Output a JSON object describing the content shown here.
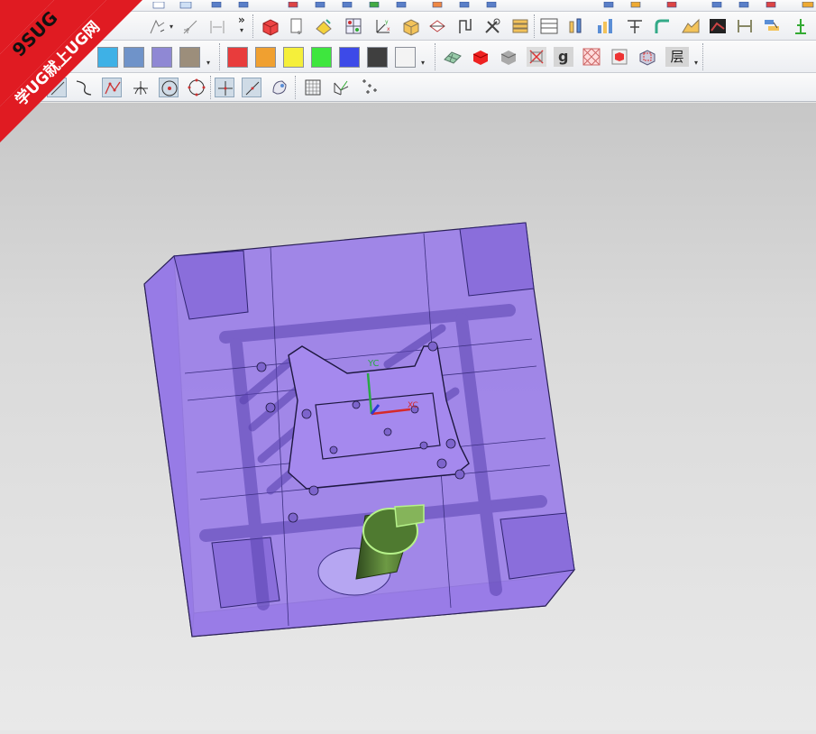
{
  "watermark": {
    "line1": "9SUG",
    "line2": "学UG就上UG网",
    "color": "#e01b22"
  },
  "toolbar_row2": {
    "overflow_label": "»",
    "layer_label": "层"
  },
  "view": {
    "wcs_y_label": "YC",
    "wcs_x_label": "XC",
    "body_color": "#9b7fe8",
    "electrode_color": "#5f8a3b",
    "background_top": "#c7c7c7",
    "background_bottom": "#e9e9e9"
  },
  "palette": [
    "#2c5aa0",
    "#3eb1e6",
    "#6f93c9",
    "#8f88d4",
    "#9c8e7b",
    "#e83c3c",
    "#f0a030",
    "#f5ef3a",
    "#3ee63e",
    "#3d4ae8",
    "#3f3f3f",
    "#f3f3f3"
  ],
  "icons": {
    "row2": [
      "box-icon",
      "file-icon",
      "paint-icon",
      "grid-icon",
      "axes-icon",
      "cube-icon",
      "section-icon",
      "shape-icon",
      "tools-icon",
      "stack-icon",
      "table-icon",
      "bars-icon",
      "chart-icon",
      "tee-icon",
      "elbow-icon",
      "surface-icon",
      "blackbox-icon",
      "network-icon",
      "tower-icon",
      "ruler-icon"
    ],
    "row3": [
      "mesh-icon",
      "red-block-icon",
      "grey-block-icon",
      "delete-icon",
      "g-icon",
      "pattern-icon",
      "small-block-icon",
      "frame-icon"
    ],
    "row4": [
      "select-icon",
      "curve-icon",
      "spline-icon",
      "intersect-icon",
      "circle-point-icon",
      "circle-icon",
      "crosshair-icon",
      "line-icon",
      "clip-icon",
      "grid-plane-icon",
      "csys-icon",
      "points-icon"
    ]
  }
}
